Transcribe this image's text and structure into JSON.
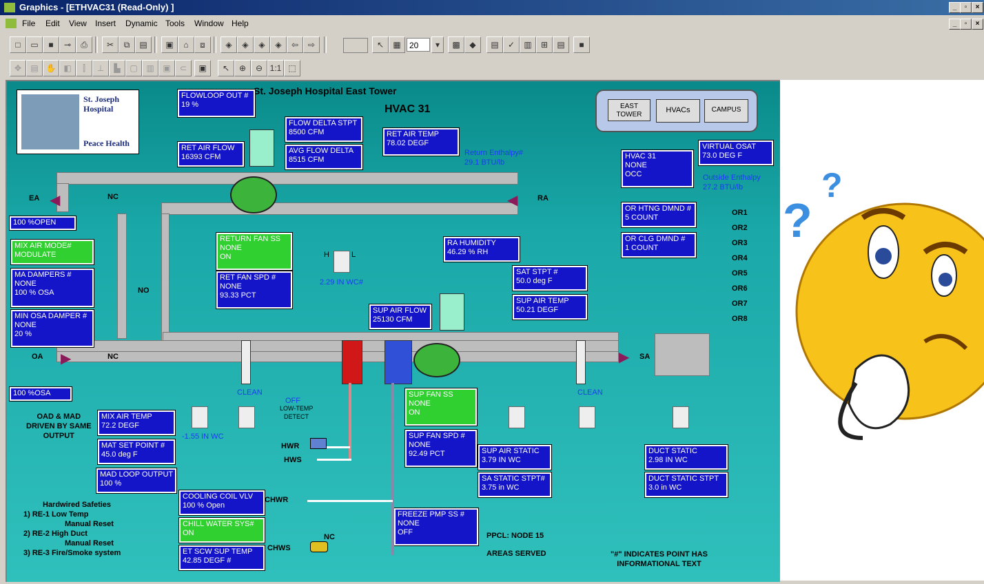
{
  "window": {
    "title": "Graphics - [ETHVAC31 (Read-Only) ]"
  },
  "menu": [
    "File",
    "Edit",
    "View",
    "Insert",
    "Dynamic",
    "Tools",
    "Window",
    "Help"
  ],
  "toolbar": {
    "zoom_value": "20"
  },
  "header": {
    "title": "St. Joseph Hospital East Tower",
    "subtitle": "HVAC 31"
  },
  "logo": {
    "line1": "St. Joseph",
    "line2": "Hospital",
    "line3": "Peace Health"
  },
  "nav": {
    "east_tower": "EAST TOWER",
    "hvacs": "HVACs",
    "campus": "CAMPUS"
  },
  "points": {
    "flowloop_out": {
      "name": "FLOWLOOP OUT #",
      "value": "19 %"
    },
    "flow_delta_stpt": {
      "name": "FLOW DELTA STPT",
      "value": "8500 CFM"
    },
    "avg_flow_delta": {
      "name": "AVG FLOW DELTA",
      "value": "8515 CFM"
    },
    "ret_air_flow": {
      "name": "RET AIR FLOW",
      "value": "16393 CFM"
    },
    "ret_air_temp": {
      "name": "RET AIR TEMP",
      "value": "78.02 DEGF"
    },
    "hvac31": {
      "name": "HVAC 31",
      "v1": "NONE",
      "v2": "OCC"
    },
    "virtual_osat": {
      "name": "VIRTUAL OSAT",
      "value": "73.0 DEG F"
    },
    "or_htng": {
      "name": "OR HTNG DMND #",
      "value": "5 COUNT"
    },
    "or_clg": {
      "name": "OR CLG DMND #",
      "value": "1 COUNT"
    },
    "mix_air_mode": {
      "name": "MIX AIR MODE#",
      "value": "MODULATE"
    },
    "ma_dampers": {
      "name": "MA DAMPERS #",
      "v1": "NONE",
      "v2": "100 % OSA"
    },
    "min_osa_damper": {
      "name": "MIN OSA DAMPER #",
      "v1": "NONE",
      "v2": "20 %"
    },
    "return_fan_ss": {
      "name": "RETURN FAN SS",
      "v1": "NONE",
      "v2": "ON"
    },
    "ret_fan_spd": {
      "name": "RET FAN SPD #",
      "v1": "NONE",
      "v2": "93.33 PCT"
    },
    "ra_humidity": {
      "name": "RA HUMIDITY",
      "value": "46.29 % RH"
    },
    "sat_stpt": {
      "name": "SAT STPT #",
      "value": "50.0 deg F"
    },
    "sup_air_temp": {
      "name": "SUP AIR TEMP",
      "value": "50.21 DEGF"
    },
    "sup_air_flow": {
      "name": "SUP AIR FLOW",
      "value": "25130 CFM"
    },
    "ea_damper": {
      "value": "100 %OPEN"
    },
    "oa_damper": {
      "value": "100 %OSA"
    },
    "mix_air_temp": {
      "name": "MIX AIR TEMP",
      "value": "72.2 DEGF"
    },
    "mat_set_point": {
      "name": "MAT SET POINT #",
      "value": "45.0 deg F"
    },
    "mad_loop_output": {
      "name": "MAD LOOP OUTPUT",
      "value": "100 %"
    },
    "sup_fan_ss": {
      "name": "SUP FAN SS",
      "v1": "NONE",
      "v2": "ON"
    },
    "sup_fan_spd": {
      "name": "SUP FAN SPD #",
      "v1": "NONE",
      "v2": "92.49 PCT"
    },
    "sup_air_static": {
      "name": "SUP AIR STATIC",
      "value": "3.79 IN WC"
    },
    "sa_static_stpt": {
      "name": "SA STATIC STPT#",
      "value": "3.75 in WC"
    },
    "duct_static": {
      "name": "DUCT STATIC",
      "value": "2.98 IN WC"
    },
    "duct_static_stpt": {
      "name": "DUCT STATIC STPT",
      "value": "3.0 in WC"
    },
    "cooling_coil_vlv": {
      "name": "COOLING COIL VLV",
      "value": "100 % Open"
    },
    "chill_water_sys": {
      "name": "CHILL WATER SYS#",
      "value": "ON"
    },
    "et_scw_sup_temp": {
      "name": "ET SCW SUP TEMP",
      "value": "42.85 DEGF #"
    },
    "freeze_pmp_ss": {
      "name": "FREEZE PMP SS #",
      "v1": "NONE",
      "v2": "OFF"
    }
  },
  "labels": {
    "return_enthalpy": "Return Enthalpy#",
    "return_enthalpy_val": "29.1 BTU/lb",
    "outside_enthalpy": "Outside Enthalpy",
    "outside_enthalpy_val": "27.2 BTU/lb",
    "ea": "EA",
    "ra": "RA",
    "oa": "OA",
    "sa": "SA",
    "nc": "NC",
    "no": "NO",
    "ret_dp": "2.29 IN WC#",
    "mix_dp": "-1.55 IN WC",
    "clean1": "CLEAN",
    "clean2": "CLEAN",
    "off": "OFF",
    "low_temp": "LOW-TEMP",
    "detect": "DETECT",
    "hwr": "HWR",
    "hws": "HWS",
    "chwr": "CHWR",
    "chws": "CHWS",
    "oad_note": [
      "OAD & MAD",
      "DRIVEN BY SAME",
      "OUTPUT"
    ],
    "safeties": [
      "Hardwired Safeties",
      "1) RE-1 Low Temp",
      "Manual Reset",
      "2) RE-2 High Duct",
      "Manual Reset",
      "3) RE-3 Fire/Smoke system"
    ],
    "ppcl": "PPCL: NODE 15",
    "areas": "AREAS SERVED",
    "note": [
      "\"#\" INDICATES POINT HAS",
      "INFORMATIONAL TEXT"
    ],
    "or_list": [
      "OR1",
      "OR2",
      "OR3",
      "OR4",
      "OR5",
      "OR6",
      "OR7",
      "OR8"
    ],
    "h": "H",
    "l": "L"
  },
  "colors": {
    "point_bg": "#1414c8",
    "status_bg": "#2fd02f",
    "canvas": "#1aa8a8"
  }
}
